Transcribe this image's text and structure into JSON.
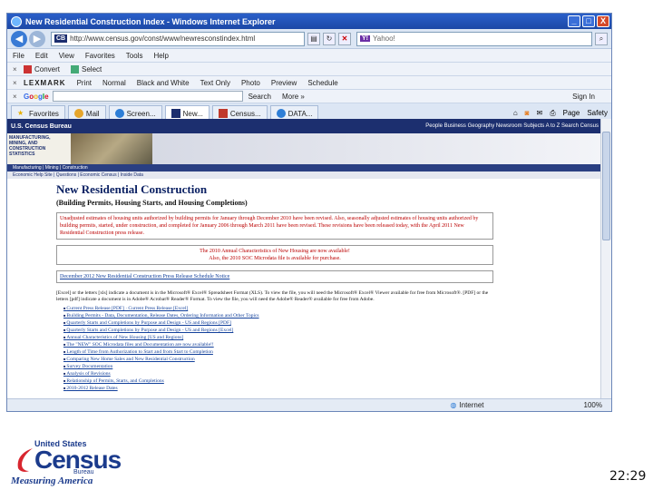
{
  "window": {
    "title": "New Residential Construction Index - Windows Internet Explorer",
    "min": "_",
    "max": "□",
    "close": "X"
  },
  "address": {
    "url": "http://www.census.gov/const/www/newresconstindex.html",
    "search_brand": "Y!",
    "search_text": "Yahoo!"
  },
  "menu": [
    "File",
    "Edit",
    "View",
    "Favorites",
    "Tools",
    "Help"
  ],
  "convert_bar": {
    "convert": "Convert",
    "select": "Select"
  },
  "lexmark_bar": {
    "brand": "LEXMARK",
    "items": [
      "Print",
      "Normal",
      "Black and White",
      "Text Only",
      "Photo",
      "Preview",
      "Schedule"
    ]
  },
  "google_bar": {
    "letters": [
      "G",
      "o",
      "o",
      "g",
      "l",
      "e"
    ],
    "search": "Search",
    "more": "More »",
    "signin": "Sign In"
  },
  "tabs": [
    {
      "label": "Favorites"
    },
    {
      "label": "Mail"
    },
    {
      "label": "Screen..."
    },
    {
      "label": "New..."
    },
    {
      "label": "Census..."
    },
    {
      "label": "DATA..."
    }
  ],
  "tools": {
    "page": "Page",
    "safety": "Safety"
  },
  "status": {
    "zone": "Internet",
    "zoom": "100%"
  },
  "site": {
    "brand": "U.S. Census Bureau",
    "top_links": "People  Business  Geography  Newsroom  Subjects A to Z  Search  Census",
    "left_block": "MANUFACTURING, MINING, AND CONSTRUCTION STATISTICS",
    "nav": "Manufacturing  |  Mining  |  Construction",
    "subnav": "Economic Help Site  |  Questions  |  Economic Census  |  Inside Data",
    "title": "New Residential Construction",
    "subtitle": "(Building Permits, Housing Starts, and Housing Completions)",
    "notice": "Unadjusted estimates of housing units authorized by building permits for January through December 2010 have been revised. Also, seasonally adjusted estimates of housing units authorized by building permits, started, under construction, and completed for January 2006 through March 2011 have been revised. These revisions have been released today, with the April 2011 New Residential Construction press release.",
    "announce_1": "The 2010 Annual Characteristics of New Housing are now available!",
    "announce_2": "Also, the 2010 SOC Microdata file is available for purchase.",
    "schedule_link": "December 2012 New Residential Construction Press Release Schedule Notice",
    "para": "[Excel] or the letters [xls] indicate a document is in the Microsoft® Excel® Spreadsheet Format (XLS). To view the file, you will need the Microsoft® Excel® Viewer available for free from Microsoft®. [PDF] or the letters [pdf] indicate a document is in Adobe® Acrobat® Reader® Format. To view the file, you will need the Adobe® Reader® available for free from Adobe.",
    "list": [
      "Current Press Release [PDF]  ·  Current Press Release [Excel]",
      "Building Permits - Data, Documentation, Release Dates, Ordering Information and Other Topics",
      "Quarterly Starts and Completions by Purpose and Design - US and Regions [PDF]",
      "Quarterly Starts and Completions by Purpose and Design - US and Regions [Excel]",
      "Annual Characteristics of New Housing [US and Regions]",
      "The \"NEW\" SOC Microdata files and Documentation are now available!!",
      "Length of Time from Authorization to Start and from Start to Completion",
      "Comparing New Home Sales and New Residential Construction",
      "Survey Documentation",
      "Analysis of Revisions",
      "Relationship of Permits, Starts, and Completions",
      "2010-2012 Release Dates"
    ]
  },
  "logo": {
    "united_states": "United States",
    "census": "Census",
    "bureau": "Bureau",
    "tagline": "Measuring America"
  },
  "clock": "22:29"
}
